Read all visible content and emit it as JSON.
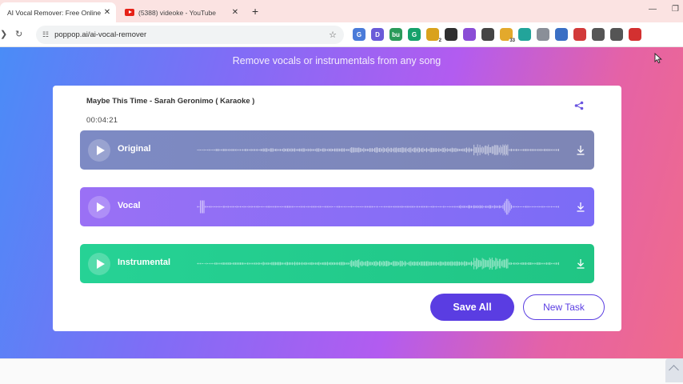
{
  "browser": {
    "tabs": [
      {
        "title": "AI Vocal Remover: Free Online V",
        "active": true
      },
      {
        "title": "(5388) videoke - YouTube",
        "active": false
      }
    ],
    "close_glyph": "✕",
    "new_tab_glyph": "+",
    "minimize_glyph": "—",
    "restore_glyph": "❐",
    "url": "poppop.ai/ai-vocal-remover",
    "extensions": [
      {
        "icon": "g-blue-icon",
        "text": "G",
        "color": "#4a7bd9"
      },
      {
        "icon": "d-purple-icon",
        "text": "D",
        "color": "#6a5bd8"
      },
      {
        "icon": "bu-green-icon",
        "text": "bu",
        "color": "#2b9a5a"
      },
      {
        "icon": "grammarly-icon",
        "text": "G",
        "color": "#15a16b"
      },
      {
        "icon": "badge-extension-icon",
        "text": "",
        "color": "#d9a21c",
        "badge": "2"
      },
      {
        "icon": "dark-square-icon",
        "text": "",
        "color": "#2f2f2f"
      },
      {
        "icon": "gear-purple-icon",
        "text": "",
        "color": "#8a4dd6"
      },
      {
        "icon": "eyedropper-icon",
        "text": "",
        "color": "#444444"
      },
      {
        "icon": "sparkle-icon",
        "text": "",
        "color": "#e3a92c",
        "badge": "33"
      },
      {
        "icon": "teal-figure-icon",
        "text": "",
        "color": "#22a49a"
      },
      {
        "icon": "camera-icon",
        "text": "",
        "color": "#8a8f98"
      },
      {
        "icon": "screenshot-icon",
        "text": "",
        "color": "#3a6fc4"
      },
      {
        "icon": "pokeball-icon",
        "text": "",
        "color": "#d23a3a"
      },
      {
        "icon": "puzzle-icon",
        "text": "",
        "color": "#555555"
      },
      {
        "icon": "media-control-icon",
        "text": "",
        "color": "#555555"
      },
      {
        "icon": "download-red-icon",
        "text": "",
        "color": "#d33030"
      }
    ]
  },
  "page": {
    "subtitle": "Remove vocals or instrumentals from any song",
    "song_title": "Maybe This Time - Sarah Geronimo ( Karaoke )",
    "duration": "00:04:21",
    "tracks": [
      {
        "label": "Original",
        "color": "#7d8ac4"
      },
      {
        "label": "Vocal",
        "color": "#8a6ef5"
      },
      {
        "label": "Instrumental",
        "color": "#24cc8e"
      }
    ],
    "save_all": "Save All",
    "new_task": "New Task",
    "accent_color": "#5a3de2"
  }
}
